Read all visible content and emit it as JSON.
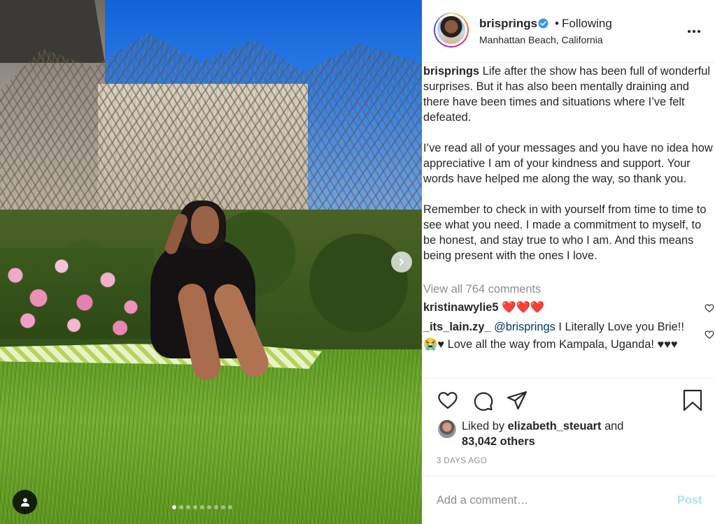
{
  "post": {
    "carousel": {
      "slide_count": 9,
      "active_slide": 1
    },
    "header": {
      "username": "brisprings",
      "separator": "•",
      "follow_status": "Following",
      "location": "Manhattan Beach, California"
    },
    "caption": {
      "username": "brisprings",
      "paragraph_1": "Life after the show has been full of wonderful surprises. But it has also been mentally draining and there have been times and situations where I’ve felt defeated.",
      "paragraph_2": "I’ve read all of your messages and you have no idea how appreciative I am of your kindness and support. Your words have helped me along the way, so thank you.",
      "paragraph_3": "Remember to check in with yourself from time to time to see what you need. I made a commitment to myself, to be honest, and stay true to who I am. And this means being present with the ones I love."
    },
    "view_all_comments": "View all 764 comments",
    "comments": [
      {
        "username": "kristinawylie5",
        "text": "❤️❤️❤️"
      },
      {
        "username": "_its_lain.zy_",
        "mention": "@brisprings",
        "text": " I Literally Love you Brie!! 😭♥ Love all the way from Kampala, Uganda! ♥♥♥"
      }
    ],
    "likes": {
      "prefix": "Liked by ",
      "user": "elizabeth_steuart",
      "middle": " and",
      "others": "83,042 others"
    },
    "timestamp": "3 DAYS AGO",
    "add_comment": {
      "placeholder": "Add a comment…",
      "post_label": "Post"
    },
    "colors": {
      "link": "#00376b",
      "muted": "#8e8e8e",
      "verified": "#3897f0",
      "post_disabled": "#b2dffc",
      "text": "#262626"
    },
    "icons": [
      "chevron-right-icon",
      "user-tag-icon",
      "verified-badge-icon",
      "more-options-icon",
      "heart-icon",
      "comment-icon",
      "share-icon",
      "bookmark-icon"
    ]
  }
}
